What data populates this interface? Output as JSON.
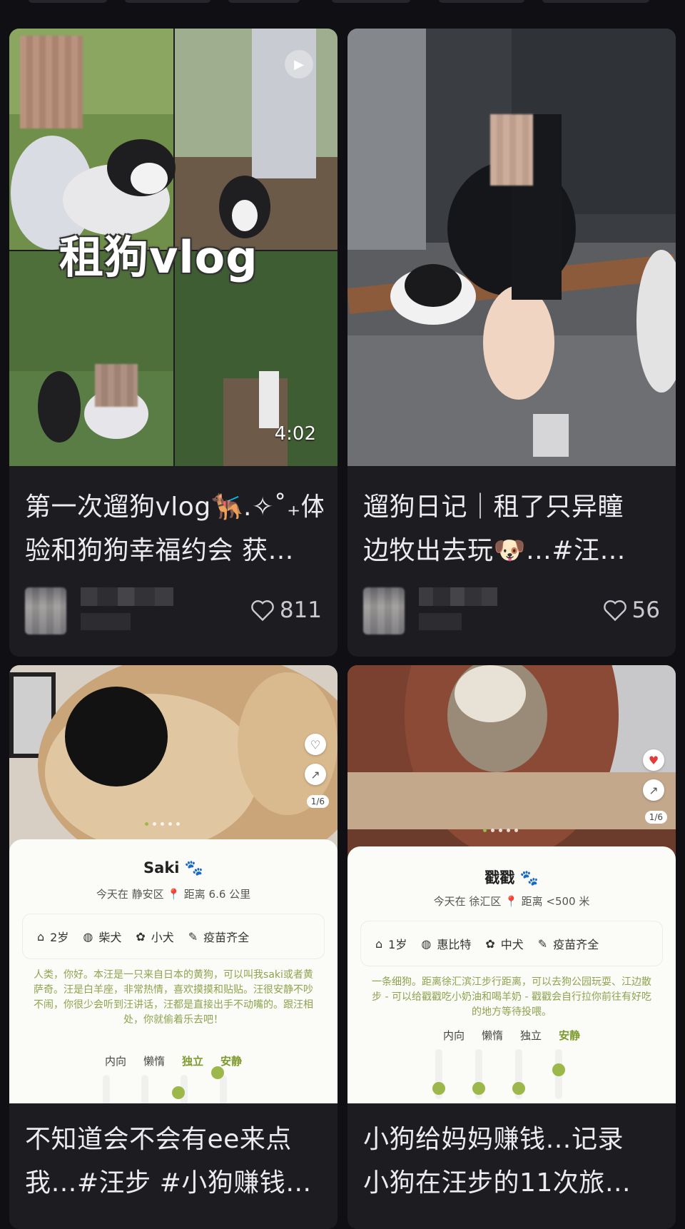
{
  "feed": {
    "cards": [
      {
        "title_lines": [
          "第一次遛狗vlog🐕‍🦺.✧˚₊体",
          "验和狗狗幸福约会 获…"
        ],
        "overlay_text": "租狗vlog",
        "duration": "4:02",
        "likes": "811"
      },
      {
        "title_lines": [
          "遛狗日记｜租了只异瞳",
          "边牧出去玩🐶…#汪…"
        ],
        "likes": "56"
      },
      {
        "title_lines": [
          "不知道会不会有ee来点",
          "我…#汪步 #小狗赚钱…"
        ],
        "pet": {
          "name": "Saki 🐾",
          "location": "今天在 静安区 📍 距离 6.6 公里",
          "attrs": [
            "2岁",
            "柴犬",
            "小犬",
            "疫苗齐全"
          ],
          "desc": "人类，你好。本汪是一只来自日本的黄狗，可以叫我saki或者黄萨奇。汪是白羊座，非常热情，喜欢摸摸和贴贴。汪很安静不吵不闹，你很少会听到汪讲话，汪都是直接出手不动嘴的。跟汪相处，你就偷着乐去吧！",
          "traits": [
            "内向",
            "懒惰",
            "独立",
            "安静"
          ],
          "page": "1/6"
        }
      },
      {
        "title_lines": [
          "小狗给妈妈赚钱…记录",
          "小狗在汪步的11次旅…"
        ],
        "pet": {
          "name": "戳戳 🐾",
          "location": "今天在 徐汇区 📍 距离 <500 米",
          "attrs": [
            "1岁",
            "惠比特",
            "中犬",
            "疫苗齐全"
          ],
          "desc": "一条细狗。距离徐汇滨江步行距离，可以去狗公园玩耍、江边散步 - 可以给戳戳吃小奶油和喝羊奶 - 戳戳会自行拉你前往有好吃的地方等待投喂。",
          "traits": [
            "内向",
            "懒惰",
            "独立",
            "安静"
          ],
          "page": "1/6"
        }
      }
    ]
  },
  "colors": {
    "background": "#101014",
    "card": "#1c1c21",
    "accent_green": "#9cb84a"
  }
}
